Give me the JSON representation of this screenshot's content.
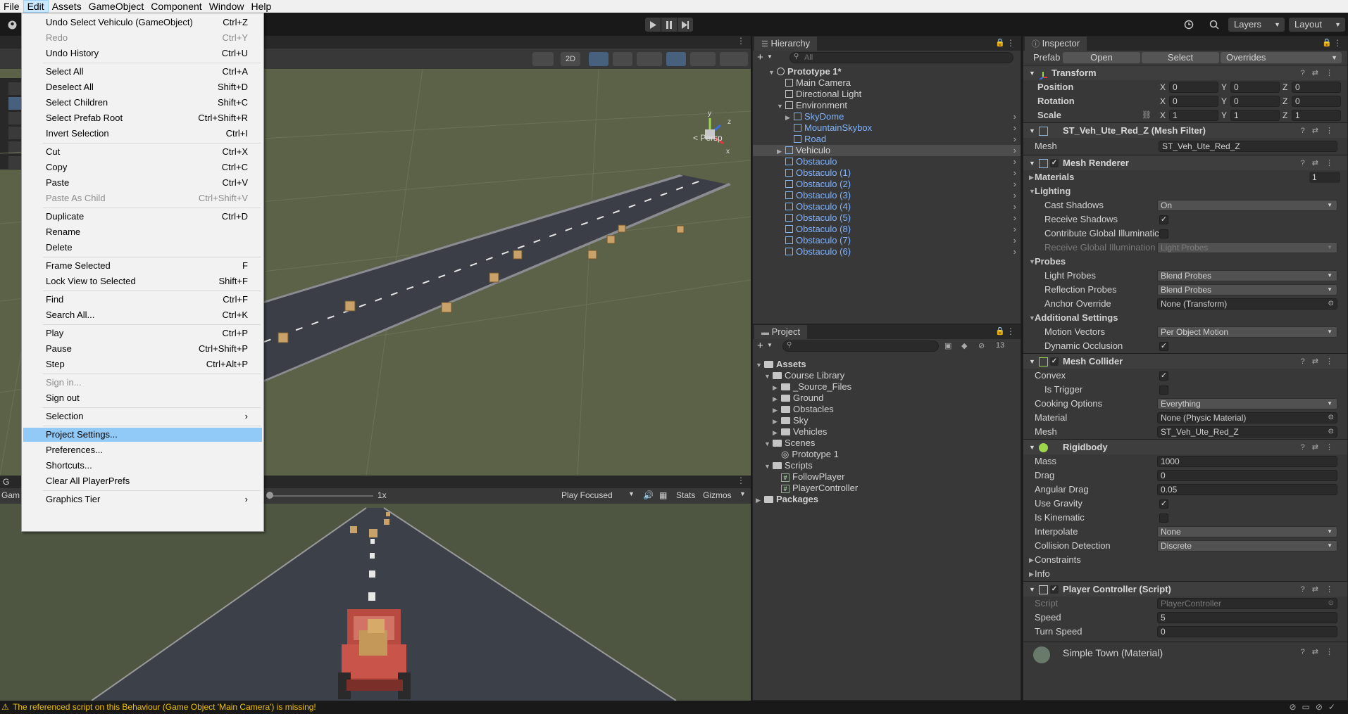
{
  "menubar": [
    "File",
    "Edit",
    "Assets",
    "GameObject",
    "Component",
    "Window",
    "Help"
  ],
  "toolbar": {
    "layers": "Layers",
    "layout": "Layout"
  },
  "scene": {
    "persp": "< Persp",
    "btn_2d": "2D",
    "axis_y": "y",
    "axis_x": "x",
    "axis_z": "z"
  },
  "game": {
    "zoom": "1x",
    "play_focused": "Play Focused",
    "stats": "Stats",
    "gizmos": "Gizmos",
    "tab_short": "G",
    "tab_label": "Gam"
  },
  "hierarchy": {
    "title": "Hierarchy",
    "search_placeholder": "All",
    "items": [
      {
        "label": "Prototype 1*",
        "indent": 0,
        "fold": "▼",
        "kind": "scene",
        "blue": false
      },
      {
        "label": "Main Camera",
        "indent": 1,
        "fold": "",
        "kind": "go",
        "blue": false
      },
      {
        "label": "Directional Light",
        "indent": 1,
        "fold": "",
        "kind": "go",
        "blue": false
      },
      {
        "label": "Environment",
        "indent": 1,
        "fold": "▼",
        "kind": "go",
        "blue": false
      },
      {
        "label": "SkyDome",
        "indent": 2,
        "fold": "▶",
        "kind": "prefab",
        "blue": true
      },
      {
        "label": "MountainSkybox",
        "indent": 2,
        "fold": "",
        "kind": "prefab",
        "blue": true
      },
      {
        "label": "Road",
        "indent": 2,
        "fold": "",
        "kind": "prefab",
        "blue": true
      },
      {
        "label": "Vehiculo",
        "indent": 1,
        "fold": "▶",
        "kind": "prefab",
        "blue": false,
        "selected": true
      },
      {
        "label": "Obstaculo",
        "indent": 1,
        "fold": "",
        "kind": "prefab",
        "blue": true
      },
      {
        "label": "Obstaculo (1)",
        "indent": 1,
        "fold": "",
        "kind": "prefab",
        "blue": true
      },
      {
        "label": "Obstaculo (2)",
        "indent": 1,
        "fold": "",
        "kind": "prefab",
        "blue": true
      },
      {
        "label": "Obstaculo (3)",
        "indent": 1,
        "fold": "",
        "kind": "prefab",
        "blue": true
      },
      {
        "label": "Obstaculo (4)",
        "indent": 1,
        "fold": "",
        "kind": "prefab",
        "blue": true
      },
      {
        "label": "Obstaculo (5)",
        "indent": 1,
        "fold": "",
        "kind": "prefab",
        "blue": true
      },
      {
        "label": "Obstaculo (8)",
        "indent": 1,
        "fold": "",
        "kind": "prefab",
        "blue": true
      },
      {
        "label": "Obstaculo (7)",
        "indent": 1,
        "fold": "",
        "kind": "prefab",
        "blue": true
      },
      {
        "label": "Obstaculo (6)",
        "indent": 1,
        "fold": "",
        "kind": "prefab",
        "blue": true
      }
    ]
  },
  "project": {
    "title": "Project",
    "count": "13",
    "items": [
      {
        "label": "Assets",
        "indent": 0,
        "fold": "▼",
        "kind": "folder",
        "bold": true
      },
      {
        "label": "Course Library",
        "indent": 1,
        "fold": "▼",
        "kind": "folder"
      },
      {
        "label": "_Source_Files",
        "indent": 2,
        "fold": "▶",
        "kind": "folder"
      },
      {
        "label": "Ground",
        "indent": 2,
        "fold": "▶",
        "kind": "folder"
      },
      {
        "label": "Obstacles",
        "indent": 2,
        "fold": "▶",
        "kind": "folder"
      },
      {
        "label": "Sky",
        "indent": 2,
        "fold": "▶",
        "kind": "folder"
      },
      {
        "label": "Vehicles",
        "indent": 2,
        "fold": "▶",
        "kind": "folder"
      },
      {
        "label": "Scenes",
        "indent": 1,
        "fold": "▼",
        "kind": "folder"
      },
      {
        "label": "Prototype 1",
        "indent": 2,
        "fold": "",
        "kind": "scene"
      },
      {
        "label": "Scripts",
        "indent": 1,
        "fold": "▼",
        "kind": "folder"
      },
      {
        "label": "FollowPlayer",
        "indent": 2,
        "fold": "",
        "kind": "script"
      },
      {
        "label": "PlayerController",
        "indent": 2,
        "fold": "",
        "kind": "script"
      },
      {
        "label": "Packages",
        "indent": 0,
        "fold": "▶",
        "kind": "folder",
        "bold": true
      }
    ]
  },
  "inspector": {
    "title": "Inspector",
    "prefab": {
      "label": "Prefab",
      "open": "Open",
      "select": "Select",
      "overrides": "Overrides"
    },
    "transform": {
      "title": "Transform",
      "position": "Position",
      "rotation": "Rotation",
      "scale": "Scale",
      "pos": [
        "0",
        "0",
        "0"
      ],
      "rot": [
        "0",
        "0",
        "0"
      ],
      "scl": [
        "1",
        "1",
        "1"
      ],
      "x": "X",
      "y": "Y",
      "z": "Z"
    },
    "mesh_filter": {
      "title": "ST_Veh_Ute_Red_Z (Mesh Filter)",
      "mesh_label": "Mesh",
      "mesh_value": "ST_Veh_Ute_Red_Z"
    },
    "mesh_renderer": {
      "title": "Mesh Renderer",
      "materials": "Materials",
      "materials_count": "1",
      "lighting": "Lighting",
      "cast_shadows": "Cast Shadows",
      "cast_shadows_val": "On",
      "receive_shadows": "Receive Shadows",
      "contribute_gi": "Contribute Global Illuminatic",
      "receive_gi": "Receive Global Illumination",
      "receive_gi_val": "Light Probes",
      "probes": "Probes",
      "light_probes": "Light Probes",
      "light_probes_val": "Blend Probes",
      "reflection_probes": "Reflection Probes",
      "reflection_probes_val": "Blend Probes",
      "anchor_override": "Anchor Override",
      "anchor_override_val": "None (Transform)",
      "additional": "Additional Settings",
      "motion_vectors": "Motion Vectors",
      "motion_vectors_val": "Per Object Motion",
      "dynamic_occlusion": "Dynamic Occlusion"
    },
    "mesh_collider": {
      "title": "Mesh Collider",
      "convex": "Convex",
      "is_trigger": "Is Trigger",
      "cooking": "Cooking Options",
      "cooking_val": "Everything",
      "material": "Material",
      "material_val": "None (Physic Material)",
      "mesh": "Mesh",
      "mesh_val": "ST_Veh_Ute_Red_Z"
    },
    "rigidbody": {
      "title": "Rigidbody",
      "mass": "Mass",
      "mass_val": "1000",
      "drag": "Drag",
      "drag_val": "0",
      "angular_drag": "Angular Drag",
      "angular_drag_val": "0.05",
      "use_gravity": "Use Gravity",
      "is_kinematic": "Is Kinematic",
      "interpolate": "Interpolate",
      "interpolate_val": "None",
      "collision_detection": "Collision Detection",
      "collision_detection_val": "Discrete",
      "constraints": "Constraints",
      "info": "Info"
    },
    "player_controller": {
      "title": "Player Controller (Script)",
      "script": "Script",
      "script_val": "PlayerController",
      "speed": "Speed",
      "speed_val": "5",
      "turn_speed": "Turn Speed",
      "turn_speed_val": "0"
    },
    "material_footer": "Simple Town (Material)",
    "check": "✓"
  },
  "edit_menu": [
    {
      "label": "Undo Select Vehiculo (GameObject)",
      "shortcut": "Ctrl+Z"
    },
    {
      "label": "Redo",
      "shortcut": "Ctrl+Y",
      "disabled": true
    },
    {
      "label": "Undo History",
      "shortcut": "Ctrl+U"
    },
    {
      "sep": true
    },
    {
      "label": "Select All",
      "shortcut": "Ctrl+A"
    },
    {
      "label": "Deselect All",
      "shortcut": "Shift+D"
    },
    {
      "label": "Select Children",
      "shortcut": "Shift+C"
    },
    {
      "label": "Select Prefab Root",
      "shortcut": "Ctrl+Shift+R"
    },
    {
      "label": "Invert Selection",
      "shortcut": "Ctrl+I"
    },
    {
      "sep": true
    },
    {
      "label": "Cut",
      "shortcut": "Ctrl+X"
    },
    {
      "label": "Copy",
      "shortcut": "Ctrl+C"
    },
    {
      "label": "Paste",
      "shortcut": "Ctrl+V"
    },
    {
      "label": "Paste As Child",
      "shortcut": "Ctrl+Shift+V",
      "disabled": true
    },
    {
      "sep": true
    },
    {
      "label": "Duplicate",
      "shortcut": "Ctrl+D"
    },
    {
      "label": "Rename",
      "shortcut": ""
    },
    {
      "label": "Delete",
      "shortcut": ""
    },
    {
      "sep": true
    },
    {
      "label": "Frame Selected",
      "shortcut": "F"
    },
    {
      "label": "Lock View to Selected",
      "shortcut": "Shift+F"
    },
    {
      "sep": true
    },
    {
      "label": "Find",
      "shortcut": "Ctrl+F"
    },
    {
      "label": "Search All...",
      "shortcut": "Ctrl+K"
    },
    {
      "sep": true
    },
    {
      "label": "Play",
      "shortcut": "Ctrl+P"
    },
    {
      "label": "Pause",
      "shortcut": "Ctrl+Shift+P"
    },
    {
      "label": "Step",
      "shortcut": "Ctrl+Alt+P"
    },
    {
      "sep": true
    },
    {
      "label": "Sign in...",
      "shortcut": "",
      "disabled": true
    },
    {
      "label": "Sign out",
      "shortcut": ""
    },
    {
      "sep": true
    },
    {
      "label": "Selection",
      "shortcut": "›"
    },
    {
      "sep": true
    },
    {
      "label": "Project Settings...",
      "shortcut": "",
      "highlighted": true
    },
    {
      "label": "Preferences...",
      "shortcut": ""
    },
    {
      "label": "Shortcuts...",
      "shortcut": ""
    },
    {
      "label": "Clear All PlayerPrefs",
      "shortcut": ""
    },
    {
      "sep": true
    },
    {
      "label": "Graphics Tier",
      "shortcut": "›"
    }
  ],
  "status": {
    "message": "The referenced script on this Behaviour (Game Object 'Main Camera') is missing!"
  }
}
